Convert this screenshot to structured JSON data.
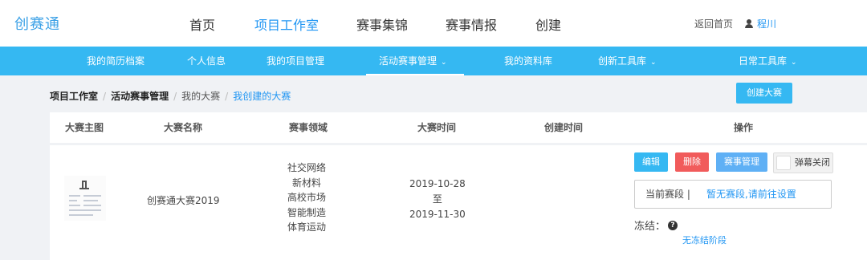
{
  "header": {
    "logo": "创赛通",
    "nav": [
      "首页",
      "项目工作室",
      "赛事集锦",
      "赛事情报",
      "创建"
    ],
    "back_home": "返回首页",
    "user_name": "程川"
  },
  "subnav": {
    "items": [
      {
        "label": "我的简历档案",
        "dropdown": false
      },
      {
        "label": "个人信息",
        "dropdown": false
      },
      {
        "label": "我的项目管理",
        "dropdown": false
      },
      {
        "label": "活动赛事管理",
        "dropdown": true
      },
      {
        "label": "我的资料库",
        "dropdown": false
      },
      {
        "label": "创新工具库",
        "dropdown": true
      },
      {
        "label": "日常工具库",
        "dropdown": true
      }
    ]
  },
  "breadcrumb": {
    "items": [
      "项目工作室",
      "活动赛事管理",
      "我的大赛",
      "我创建的大赛"
    ],
    "separator": "/"
  },
  "create_button": "创建大赛",
  "table": {
    "headers": [
      "大赛主图",
      "大赛名称",
      "赛事领域",
      "大赛时间",
      "创建时间",
      "操作"
    ],
    "row": {
      "name": "创赛通大赛2019",
      "domains": [
        "社交网络",
        "新材料",
        "高校市场",
        "智能制造",
        "体育运动"
      ],
      "start": "2019-10-28",
      "to": "至",
      "end": "2019-11-30",
      "created": ""
    }
  },
  "actions": {
    "edit": "编辑",
    "delete": "删除",
    "manage": "赛事管理",
    "barrage_toggle": "弹幕关闭",
    "stage_label": "当前赛段 |",
    "stage_link": "暂无赛段,请前往设置",
    "freeze_label": "冻结：",
    "freeze_link": "无冻结阶段"
  },
  "colors": {
    "accent": "#35b8f2",
    "link": "#2196f3",
    "danger": "#f15b5b",
    "manage": "#5fb0f5"
  }
}
